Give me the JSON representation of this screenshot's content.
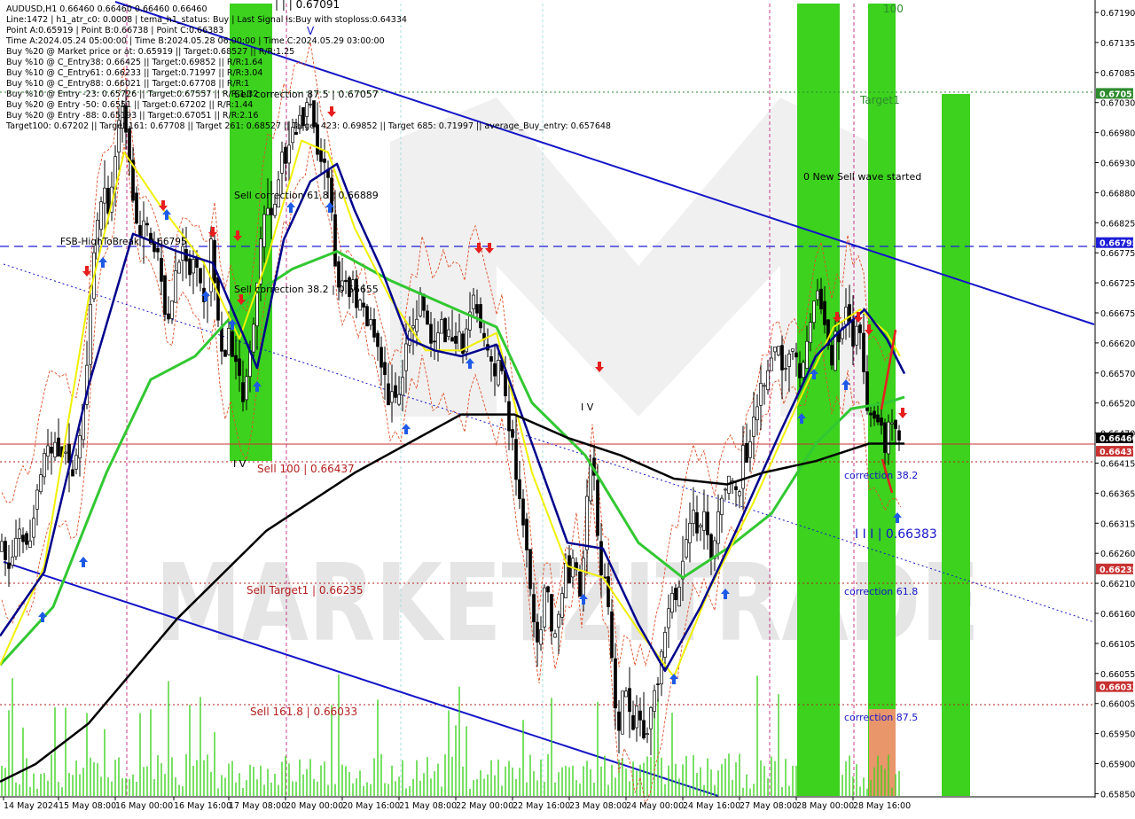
{
  "header": {
    "lines": [
      "AUDUSD,H1  0.66460 0.66460 0.66460 0.66460",
      "Line:1472 | h1_atr_c0: 0.0008 | tema_h1_status: Buy | Last Signal is:Buy with stoploss:0.64334",
      "Point A:0.65919 | Point B:0.66738 | Point C:0.66383",
      "Time A:2024.05.24 05:00:00 | Time B:2024.05.28 06:00:00 | Time C:2024.05.29 03:00:00",
      "Buy %20 @ Market price or at: 0.65919 || Target:0.68527 || R/R:1.25",
      "Buy %10 @ C_Entry38: 0.66425 || Target:0.69852 || R/R:1.64",
      "Buy %10 @ C_Entry61: 0.66233 || Target:0.71997 || R/R:3.04",
      "Buy %10 @ C_Entry88: 0.66021 || Target:0.67708 || R/R:1",
      "Buy %10 @ Entry -23: 0.65726 || Target:0.67557 || R/R:1.32",
      "Buy %20 @ Entry -50: 0.6551 || Target:0.67202 || R/R:1.44",
      "Buy %20 @ Entry -88: 0.65193 || Target:0.67051 || R/R:2.16",
      "Target100: 0.67202 || Target 161: 0.67708 || Target 261: 0.68527 || Target 423: 0.69852 || Target 685: 0.71997 || average_Buy_entry: 0.657648"
    ]
  },
  "watermark": "MARKETZITRADE",
  "annotations": {
    "top_value": "| | | 0.67091",
    "top_v": "V",
    "target1": "Target1",
    "new_sell_wave": "0 New Sell wave started",
    "sell_correction_87": "Sell correction 87.5 | 0.67057",
    "sell_correction_61": "Sell correction 61.8 | 0.66889",
    "sell_correction_38": "Sell correction 38.2 | 0.66655",
    "fsb": "FSB-HighToBreak | 0.66795",
    "sell_100": "Sell 100 | 0.66437",
    "sell_target1": "Sell Target1 | 0.66235",
    "sell_161": "Sell 161.8 | 0.66033",
    "iv_left": "I V",
    "iv_mid": "I V",
    "point_c": "I I I | 0.66383",
    "correction_38": "correction 38.2",
    "correction_61": "correction 61.8",
    "correction_87": "correction 87.5",
    "top_right_100": "100"
  },
  "price_tags": [
    {
      "price": 0.67051,
      "label": "0.67051",
      "color": "#2e8b2e"
    },
    {
      "price": 0.66795,
      "label": "0.66795",
      "color": "#1e1ed8"
    },
    {
      "price": 0.6646,
      "label": "0.66460",
      "color": "#000000"
    },
    {
      "price": 0.66437,
      "label": "0.66437",
      "color": "#c83232"
    },
    {
      "price": 0.66235,
      "label": "0.66235",
      "color": "#c83232"
    },
    {
      "price": 0.66033,
      "label": "0.66033",
      "color": "#c83232"
    }
  ],
  "colors": {
    "green_zone": "#3cd21e",
    "blue_line": "#1414c8",
    "red_level": "#b41e1e",
    "ema_black": "#000000",
    "ema_green": "#32c832",
    "ema_navy": "#00008c",
    "ema_yellow": "#f0f000"
  },
  "chart_data": {
    "type": "candlestick",
    "symbol": "AUDUSD",
    "timeframe": "H1",
    "ylim": [
      0.65885,
      0.6719
    ],
    "yticks": [
      "0.67190",
      "0.67135",
      "0.67085",
      "0.67030",
      "0.66980",
      "0.66930",
      "0.66880",
      "0.66825",
      "0.66775",
      "0.66725",
      "0.66675",
      "0.66620",
      "0.66570",
      "0.66520",
      "0.66470",
      "0.66415",
      "0.66365",
      "0.66315",
      "0.66260",
      "0.66210",
      "0.66160",
      "0.66105",
      "0.66055",
      "0.66005",
      "0.65950",
      "0.65900",
      "0.65850"
    ],
    "xticks": [
      "14 May 2024",
      "15 May 08:00",
      "16 May 00:00",
      "16 May 16:00",
      "17 May 08:00",
      "20 May 00:00",
      "20 May 16:00",
      "21 May 08:00",
      "22 May 00:00",
      "22 May 16:00",
      "23 May 08:00",
      "24 May 00:00",
      "24 May 16:00",
      "27 May 08:00",
      "28 May 00:00",
      "28 May 16:00"
    ],
    "close_path": [
      [
        0,
        0.6627
      ],
      [
        5,
        0.6628
      ],
      [
        10,
        0.6623
      ],
      [
        15,
        0.6625
      ],
      [
        20,
        0.6628
      ],
      [
        25,
        0.663
      ],
      [
        30,
        0.6628
      ],
      [
        35,
        0.6627
      ],
      [
        40,
        0.6633
      ],
      [
        45,
        0.6638
      ],
      [
        50,
        0.6641
      ],
      [
        55,
        0.6645
      ],
      [
        60,
        0.6643
      ],
      [
        65,
        0.6646
      ],
      [
        70,
        0.6642
      ],
      [
        75,
        0.6645
      ],
      [
        80,
        0.6641
      ],
      [
        85,
        0.664
      ],
      [
        90,
        0.6645
      ],
      [
        95,
        0.6649
      ],
      [
        100,
        0.6659
      ],
      [
        105,
        0.6672
      ],
      [
        110,
        0.6681
      ],
      [
        115,
        0.6685
      ],
      [
        120,
        0.6689
      ],
      [
        125,
        0.6684
      ],
      [
        130,
        0.6692
      ],
      [
        135,
        0.6699
      ],
      [
        140,
        0.6703
      ],
      [
        145,
        0.6698
      ],
      [
        150,
        0.669
      ],
      [
        155,
        0.6684
      ],
      [
        160,
        0.668
      ],
      [
        165,
        0.6683
      ],
      [
        170,
        0.6681
      ],
      [
        175,
        0.6679
      ],
      [
        180,
        0.6677
      ],
      [
        185,
        0.6672
      ],
      [
        190,
        0.6665
      ],
      [
        195,
        0.6668
      ],
      [
        200,
        0.6675
      ],
      [
        205,
        0.6677
      ],
      [
        210,
        0.6679
      ],
      [
        215,
        0.6673
      ],
      [
        220,
        0.6676
      ],
      [
        225,
        0.6674
      ],
      [
        230,
        0.6671
      ],
      [
        235,
        0.6668
      ],
      [
        240,
        0.668
      ],
      [
        245,
        0.6671
      ],
      [
        250,
        0.6662
      ],
      [
        255,
        0.666
      ],
      [
        260,
        0.6664
      ],
      [
        265,
        0.666
      ],
      [
        270,
        0.6659
      ],
      [
        275,
        0.6652
      ],
      [
        280,
        0.6657
      ],
      [
        285,
        0.6661
      ],
      [
        290,
        0.6668
      ],
      [
        295,
        0.6678
      ],
      [
        300,
        0.6685
      ],
      [
        305,
        0.6686
      ],
      [
        310,
        0.6684
      ],
      [
        315,
        0.669
      ],
      [
        320,
        0.6695
      ],
      [
        325,
        0.6692
      ],
      [
        330,
        0.67
      ],
      [
        335,
        0.6698
      ],
      [
        340,
        0.6702
      ],
      [
        345,
        0.67
      ],
      [
        350,
        0.6705
      ],
      [
        355,
        0.6701
      ],
      [
        360,
        0.6695
      ],
      [
        365,
        0.6693
      ],
      [
        370,
        0.6692
      ],
      [
        375,
        0.6687
      ],
      [
        380,
        0.6676
      ],
      [
        385,
        0.667
      ],
      [
        390,
        0.6675
      ],
      [
        395,
        0.667
      ],
      [
        400,
        0.6673
      ],
      [
        405,
        0.6667
      ],
      [
        410,
        0.6671
      ],
      [
        415,
        0.6665
      ],
      [
        420,
        0.6667
      ],
      [
        425,
        0.6663
      ],
      [
        430,
        0.666
      ],
      [
        435,
        0.6657
      ],
      [
        440,
        0.6652
      ],
      [
        445,
        0.6655
      ],
      [
        450,
        0.6651
      ],
      [
        455,
        0.6656
      ],
      [
        460,
        0.6662
      ],
      [
        465,
        0.6666
      ],
      [
        470,
        0.6664
      ],
      [
        475,
        0.6671
      ],
      [
        480,
        0.6668
      ],
      [
        485,
        0.6665
      ],
      [
        490,
        0.666
      ],
      [
        495,
        0.6664
      ],
      [
        500,
        0.6666
      ],
      [
        505,
        0.6662
      ],
      [
        510,
        0.6665
      ],
      [
        515,
        0.6661
      ],
      [
        520,
        0.6664
      ],
      [
        525,
        0.6659
      ],
      [
        530,
        0.6667
      ],
      [
        535,
        0.667
      ],
      [
        540,
        0.6668
      ],
      [
        545,
        0.6664
      ],
      [
        550,
        0.6662
      ],
      [
        555,
        0.6659
      ],
      [
        560,
        0.6656
      ],
      [
        565,
        0.6661
      ],
      [
        570,
        0.6656
      ],
      [
        575,
        0.6648
      ],
      [
        580,
        0.6646
      ],
      [
        585,
        0.6636
      ],
      [
        590,
        0.6634
      ],
      [
        595,
        0.6628
      ],
      [
        600,
        0.662
      ],
      [
        605,
        0.6612
      ],
      [
        610,
        0.6609
      ],
      [
        615,
        0.6621
      ],
      [
        620,
        0.6619
      ],
      [
        625,
        0.6611
      ],
      [
        630,
        0.6614
      ],
      [
        635,
        0.6618
      ],
      [
        640,
        0.6625
      ],
      [
        645,
        0.6621
      ],
      [
        650,
        0.6628
      ],
      [
        655,
        0.6617
      ],
      [
        660,
        0.6626
      ],
      [
        665,
        0.6638
      ],
      [
        670,
        0.6645
      ],
      [
        675,
        0.663
      ],
      [
        680,
        0.6622
      ],
      [
        685,
        0.6623
      ],
      [
        690,
        0.6613
      ],
      [
        695,
        0.66
      ],
      [
        700,
        0.6596
      ],
      [
        705,
        0.6604
      ],
      [
        710,
        0.6601
      ],
      [
        715,
        0.6595
      ],
      [
        720,
        0.66
      ],
      [
        725,
        0.6598
      ],
      [
        730,
        0.6593
      ],
      [
        735,
        0.6599
      ],
      [
        740,
        0.6603
      ],
      [
        745,
        0.6605
      ],
      [
        750,
        0.6611
      ],
      [
        755,
        0.6615
      ],
      [
        760,
        0.662
      ],
      [
        765,
        0.6617
      ],
      [
        770,
        0.6624
      ],
      [
        775,
        0.6628
      ],
      [
        780,
        0.6632
      ],
      [
        785,
        0.6634
      ],
      [
        790,
        0.6628
      ],
      [
        795,
        0.6634
      ],
      [
        800,
        0.6629
      ],
      [
        805,
        0.6625
      ],
      [
        810,
        0.6631
      ],
      [
        815,
        0.6636
      ],
      [
        820,
        0.6637
      ],
      [
        825,
        0.6639
      ],
      [
        830,
        0.6637
      ],
      [
        835,
        0.6635
      ],
      [
        840,
        0.6645
      ],
      [
        845,
        0.6642
      ],
      [
        850,
        0.6649
      ],
      [
        855,
        0.665
      ],
      [
        860,
        0.6655
      ],
      [
        865,
        0.6654
      ],
      [
        870,
        0.666
      ],
      [
        875,
        0.6661
      ],
      [
        880,
        0.6661
      ],
      [
        885,
        0.6656
      ],
      [
        890,
        0.666
      ],
      [
        895,
        0.6661
      ],
      [
        900,
        0.6659
      ],
      [
        905,
        0.6656
      ],
      [
        910,
        0.666
      ],
      [
        915,
        0.6665
      ],
      [
        920,
        0.6669
      ],
      [
        925,
        0.6672
      ],
      [
        930,
        0.6667
      ],
      [
        935,
        0.6663
      ],
      [
        940,
        0.6658
      ],
      [
        945,
        0.6665
      ],
      [
        950,
        0.6661
      ],
      [
        955,
        0.667
      ],
      [
        960,
        0.6666
      ],
      [
        965,
        0.666
      ],
      [
        970,
        0.6668
      ],
      [
        975,
        0.666
      ],
      [
        980,
        0.665
      ],
      [
        985,
        0.6651
      ],
      [
        990,
        0.6648
      ],
      [
        995,
        0.665
      ],
      [
        1000,
        0.6644
      ],
      [
        1005,
        0.6649
      ],
      [
        1010,
        0.6648
      ],
      [
        1015,
        0.6646
      ]
    ],
    "ema_black": [
      [
        0,
        0.6587
      ],
      [
        40,
        0.659
      ],
      [
        100,
        0.6597
      ],
      [
        200,
        0.6615
      ],
      [
        300,
        0.663
      ],
      [
        400,
        0.664
      ],
      [
        460,
        0.6645
      ],
      [
        520,
        0.665
      ],
      [
        580,
        0.665
      ],
      [
        640,
        0.6646
      ],
      [
        700,
        0.6643
      ],
      [
        760,
        0.6639
      ],
      [
        820,
        0.6638
      ],
      [
        860,
        0.664
      ],
      [
        920,
        0.6642
      ],
      [
        980,
        0.6645
      ],
      [
        1020,
        0.6645
      ]
    ],
    "ema_green": [
      [
        0,
        0.6607
      ],
      [
        60,
        0.6617
      ],
      [
        120,
        0.664
      ],
      [
        170,
        0.6656
      ],
      [
        220,
        0.666
      ],
      [
        280,
        0.667
      ],
      [
        330,
        0.6675
      ],
      [
        380,
        0.6678
      ],
      [
        440,
        0.6673
      ],
      [
        500,
        0.6669
      ],
      [
        560,
        0.6665
      ],
      [
        600,
        0.6652
      ],
      [
        660,
        0.6643
      ],
      [
        720,
        0.6628
      ],
      [
        770,
        0.6622
      ],
      [
        820,
        0.6627
      ],
      [
        870,
        0.6633
      ],
      [
        920,
        0.6645
      ],
      [
        960,
        0.6651
      ],
      [
        1000,
        0.6652
      ],
      [
        1020,
        0.6653
      ]
    ],
    "ema_navy": [
      [
        0,
        0.6612
      ],
      [
        50,
        0.6623
      ],
      [
        100,
        0.6655
      ],
      [
        150,
        0.6681
      ],
      [
        200,
        0.6678
      ],
      [
        240,
        0.6676
      ],
      [
        290,
        0.6658
      ],
      [
        320,
        0.668
      ],
      [
        350,
        0.669
      ],
      [
        380,
        0.6693
      ],
      [
        400,
        0.6685
      ],
      [
        430,
        0.6675
      ],
      [
        460,
        0.6663
      ],
      [
        490,
        0.6661
      ],
      [
        520,
        0.666
      ],
      [
        560,
        0.6662
      ],
      [
        600,
        0.6645
      ],
      [
        640,
        0.6628
      ],
      [
        680,
        0.6627
      ],
      [
        720,
        0.6614
      ],
      [
        750,
        0.6606
      ],
      [
        790,
        0.6617
      ],
      [
        830,
        0.663
      ],
      [
        880,
        0.6647
      ],
      [
        920,
        0.666
      ],
      [
        945,
        0.6664
      ],
      [
        975,
        0.6668
      ],
      [
        1000,
        0.6663
      ],
      [
        1020,
        0.6657
      ]
    ],
    "ema_yellow": [
      [
        0,
        0.6607
      ],
      [
        50,
        0.6624
      ],
      [
        100,
        0.667
      ],
      [
        140,
        0.6695
      ],
      [
        180,
        0.6686
      ],
      [
        230,
        0.6676
      ],
      [
        270,
        0.6663
      ],
      [
        300,
        0.6676
      ],
      [
        340,
        0.6697
      ],
      [
        370,
        0.6695
      ],
      [
        400,
        0.6682
      ],
      [
        440,
        0.667
      ],
      [
        480,
        0.6661
      ],
      [
        520,
        0.6661
      ],
      [
        560,
        0.6664
      ],
      [
        600,
        0.664
      ],
      [
        640,
        0.6624
      ],
      [
        680,
        0.6622
      ],
      [
        720,
        0.6613
      ],
      [
        760,
        0.6605
      ],
      [
        800,
        0.662
      ],
      [
        850,
        0.6635
      ],
      [
        900,
        0.6652
      ],
      [
        940,
        0.6665
      ],
      [
        970,
        0.6668
      ],
      [
        1000,
        0.6664
      ],
      [
        1015,
        0.666
      ]
    ]
  }
}
